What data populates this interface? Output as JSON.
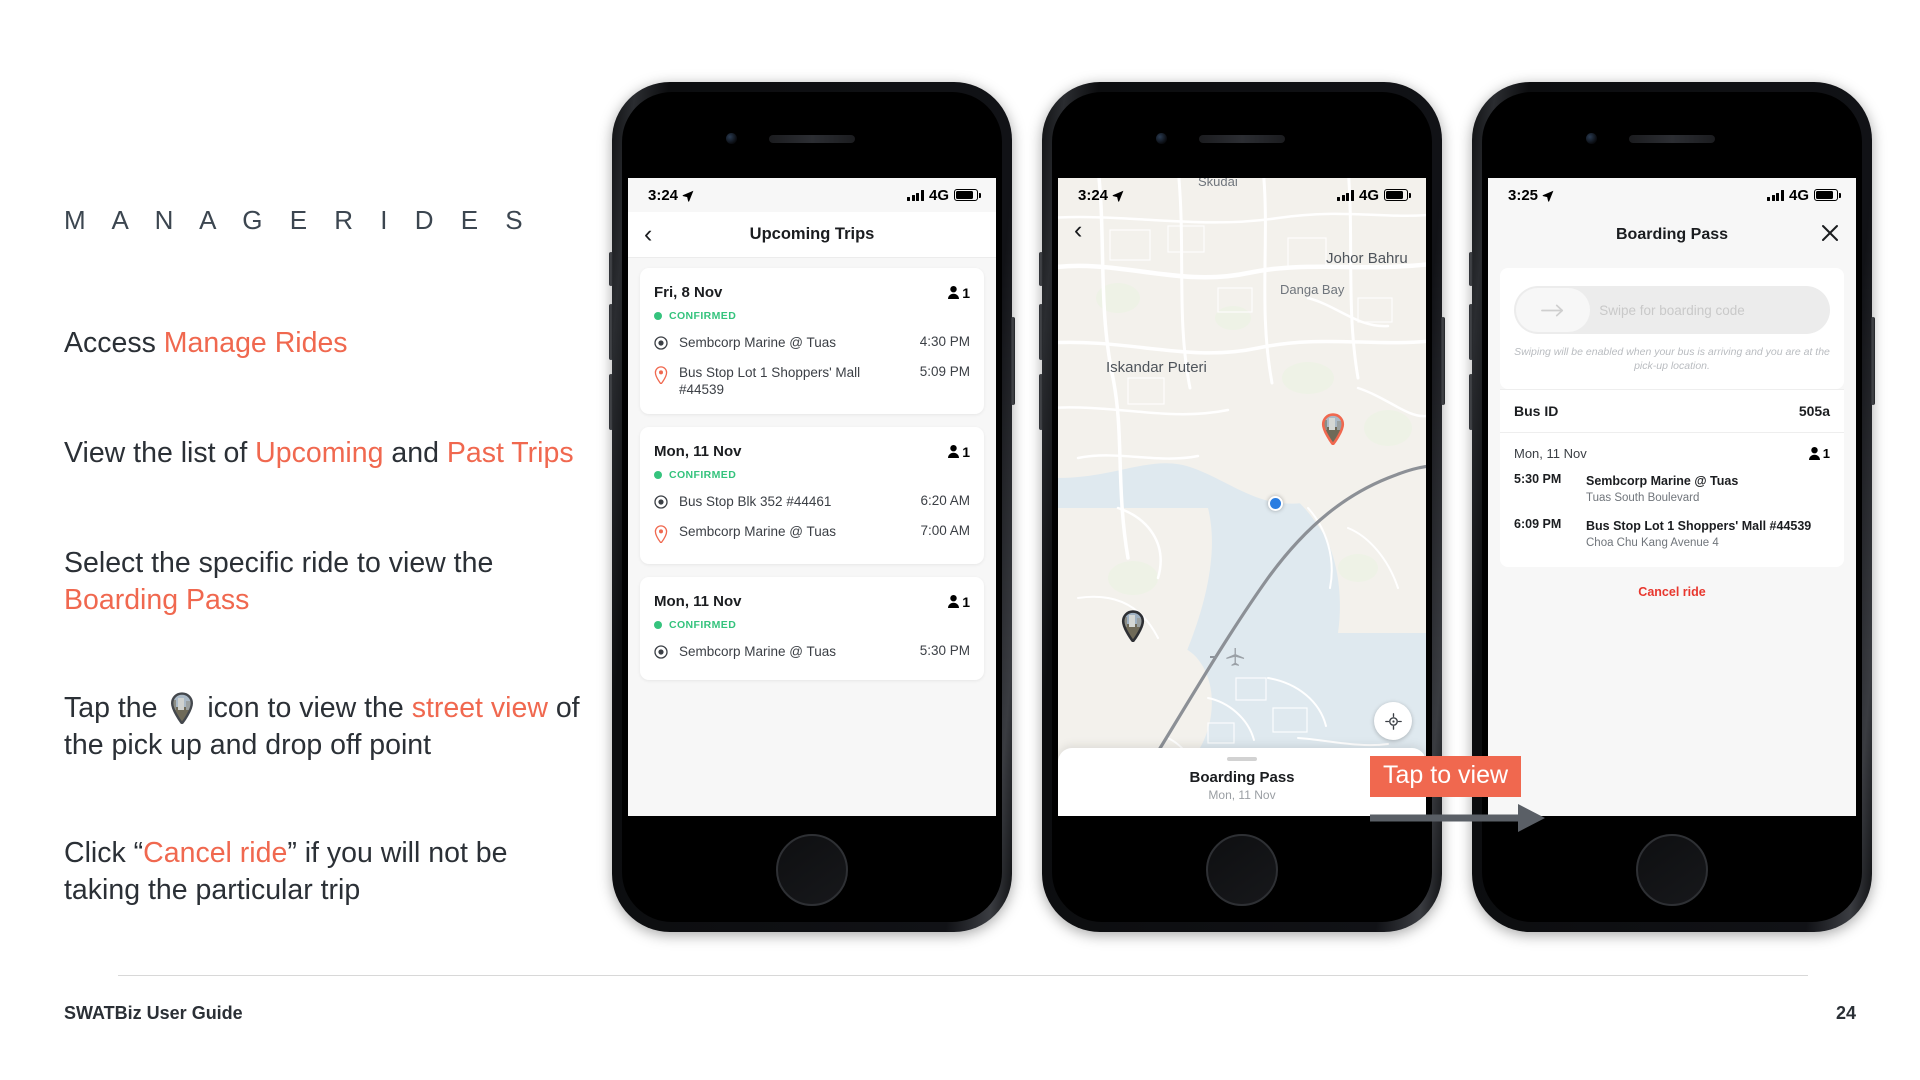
{
  "slide": {
    "kicker": "M A N A G E   R I D E S",
    "paragraphs": [
      {
        "parts": [
          {
            "t": "Access ",
            "hl": false
          },
          {
            "t": "Manage Rides",
            "hl": true
          }
        ]
      },
      {
        "parts": [
          {
            "t": "View the list of ",
            "hl": false
          },
          {
            "t": "Upcoming",
            "hl": true
          },
          {
            "t": " and ",
            "hl": false
          },
          {
            "t": "Past Trips",
            "hl": true
          }
        ]
      },
      {
        "parts": [
          {
            "t": "Select the specific ride to view the ",
            "hl": false
          },
          {
            "t": "Boarding Pass",
            "hl": true
          }
        ]
      },
      {
        "parts": [
          {
            "t": "Tap the ",
            "hl": false
          },
          {
            "t": "[street-view-icon]",
            "hl": false,
            "icon": "street-view-pin-icon"
          },
          {
            "t": " icon to view the ",
            "hl": false
          },
          {
            "t": "street view",
            "hl": true
          },
          {
            "t": " of the pick up and drop off point",
            "hl": false
          }
        ]
      },
      {
        "parts": [
          {
            "t": "Click “",
            "hl": false
          },
          {
            "t": "Cancel ride",
            "hl": true
          },
          {
            "t": "” if you will not be taking the particular trip",
            "hl": false
          }
        ]
      }
    ],
    "footer": {
      "left": "SWATBiz User Guide",
      "right": "24"
    },
    "accent_color": "#f0684f",
    "text_color": "#2b3036"
  },
  "callout": {
    "label": "Tap to view"
  },
  "phone1": {
    "status": {
      "time": "3:24",
      "network": "4G"
    },
    "nav": {
      "back_icon": "chevron-left-icon",
      "title": "Upcoming Trips"
    },
    "cards": [
      {
        "date": "Fri, 8 Nov",
        "pax": "1",
        "status": "CONFIRMED",
        "legs": [
          {
            "icon": "pickup-radio-icon",
            "name": "Sembcorp Marine @ Tuas",
            "time": "4:30 PM"
          },
          {
            "icon": "dropoff-pin-icon",
            "name": "Bus Stop Lot 1 Shoppers' Mall #44539",
            "time": "5:09 PM"
          }
        ]
      },
      {
        "date": "Mon, 11 Nov",
        "pax": "1",
        "status": "CONFIRMED",
        "legs": [
          {
            "icon": "pickup-radio-icon",
            "name": "Bus Stop Blk 352 #44461",
            "time": "6:20 AM"
          },
          {
            "icon": "dropoff-pin-icon",
            "name": "Sembcorp Marine @ Tuas",
            "time": "7:00 AM"
          }
        ]
      },
      {
        "date": "Mon, 11 Nov",
        "pax": "1",
        "status": "CONFIRMED",
        "legs": [
          {
            "icon": "pickup-radio-icon",
            "name": "Sembcorp Marine @ Tuas",
            "time": "5:30 PM"
          }
        ]
      }
    ]
  },
  "phone2": {
    "status": {
      "time": "3:24",
      "network": "4G"
    },
    "back_icon": "chevron-left-icon",
    "map_labels": [
      {
        "text": "Skudai",
        "size": 13
      },
      {
        "text": "Johor Bahru",
        "size": 15
      },
      {
        "text": "Danga Bay",
        "size": 13
      },
      {
        "text": "Iskandar Puteri",
        "size": 15
      }
    ],
    "sheet": {
      "title": "Boarding Pass",
      "subtitle": "Mon, 11 Nov"
    }
  },
  "phone3": {
    "status": {
      "time": "3:25",
      "network": "4G"
    },
    "nav": {
      "title": "Boarding Pass",
      "close_icon": "close-icon"
    },
    "swipe": {
      "label": "Swipe for boarding code",
      "note": "Swiping will be enabled when your bus is arriving and you are at the pick-up location.",
      "arrow_icon": "arrow-right-icon"
    },
    "bus_id": {
      "key": "Bus ID",
      "value": "505a"
    },
    "detail": {
      "date": "Mon, 11 Nov",
      "pax": "1",
      "rows": [
        {
          "time": "5:30 PM",
          "name": "Sembcorp Marine @ Tuas",
          "sub": "Tuas South Boulevard"
        },
        {
          "time": "6:09 PM",
          "name": "Bus Stop Lot 1 Shoppers' Mall #44539",
          "sub": "Choa Chu Kang Avenue 4"
        }
      ]
    },
    "cancel_label": "Cancel ride"
  }
}
